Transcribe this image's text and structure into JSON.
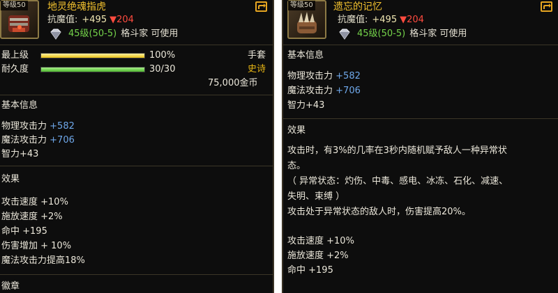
{
  "left": {
    "slot_level": "等级50",
    "item_name": "地灵绝魂指虎",
    "resist_label": "抗魔值:",
    "resist_up": "+495",
    "resist_down": "▼204",
    "req_level": "45级(50-5)",
    "req_class": "格斗家 可使用",
    "upgrade_label": "最上级",
    "upgrade_value": "100%",
    "upgrade_fraction": 1.0,
    "upgrade_color": "#e8c117",
    "durability_label": "耐久度",
    "durability_value": "30/30",
    "durability_fraction": 1.0,
    "durability_color": "#4fb82e",
    "item_type": "手套",
    "rarity": "史诗",
    "rarity_color": "#e8b614",
    "price": "75,000金币",
    "basic_title": "基本信息",
    "stats": [
      {
        "label": "物理攻击力",
        "value": "+582"
      },
      {
        "label": "魔法攻击力",
        "value": "+706"
      },
      {
        "label": "智力+43",
        "value": ""
      }
    ],
    "effect_title": "效果",
    "effects": [
      "攻击速度 +10%",
      "施放速度 +2%",
      "命中 +195",
      "伤害增加 + 10%",
      "魔法攻击力提高18%"
    ],
    "badge_title": "徽章"
  },
  "right": {
    "slot_level": "等级50",
    "item_name": "遗忘的记忆",
    "resist_label": "抗魔值:",
    "resist_up": "+495",
    "resist_down": "▼204",
    "req_level": "45级(50-5)",
    "req_class": "格斗家 可使用",
    "basic_title": "基本信息",
    "stats": [
      {
        "label": "物理攻击力",
        "value": "+582"
      },
      {
        "label": "魔法攻击力",
        "value": "+706"
      },
      {
        "label": "智力+43",
        "value": ""
      }
    ],
    "effect_title": "效果",
    "effect_desc": [
      "攻击时，有3%的几率在3秒内随机赋予敌人一种异常状",
      "态。",
      "（ 异常状态：灼伤、中毒、感电、冰冻、石化、减速、",
      "失明、束缚 ）",
      "攻击处于异常状态的敌人时，伤害提高20%。"
    ],
    "effects": [
      "攻击速度 +10%",
      "施放速度 +2%",
      "命中 +195"
    ]
  },
  "icons": [
    "gauntlet-icon",
    "claw-icon",
    "gem-icon",
    "share-icon"
  ]
}
